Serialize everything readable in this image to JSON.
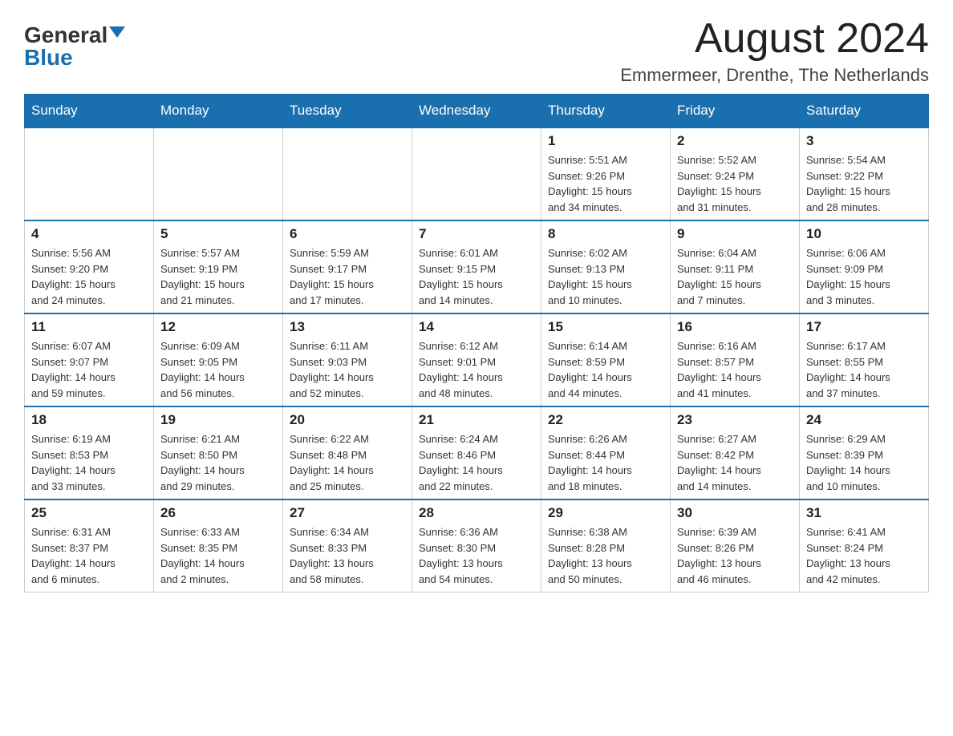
{
  "header": {
    "logo_general": "General",
    "logo_blue": "Blue",
    "month_title": "August 2024",
    "location": "Emmermeer, Drenthe, The Netherlands"
  },
  "weekdays": [
    "Sunday",
    "Monday",
    "Tuesday",
    "Wednesday",
    "Thursday",
    "Friday",
    "Saturday"
  ],
  "weeks": [
    [
      {
        "day": "",
        "info": ""
      },
      {
        "day": "",
        "info": ""
      },
      {
        "day": "",
        "info": ""
      },
      {
        "day": "",
        "info": ""
      },
      {
        "day": "1",
        "info": "Sunrise: 5:51 AM\nSunset: 9:26 PM\nDaylight: 15 hours\nand 34 minutes."
      },
      {
        "day": "2",
        "info": "Sunrise: 5:52 AM\nSunset: 9:24 PM\nDaylight: 15 hours\nand 31 minutes."
      },
      {
        "day": "3",
        "info": "Sunrise: 5:54 AM\nSunset: 9:22 PM\nDaylight: 15 hours\nand 28 minutes."
      }
    ],
    [
      {
        "day": "4",
        "info": "Sunrise: 5:56 AM\nSunset: 9:20 PM\nDaylight: 15 hours\nand 24 minutes."
      },
      {
        "day": "5",
        "info": "Sunrise: 5:57 AM\nSunset: 9:19 PM\nDaylight: 15 hours\nand 21 minutes."
      },
      {
        "day": "6",
        "info": "Sunrise: 5:59 AM\nSunset: 9:17 PM\nDaylight: 15 hours\nand 17 minutes."
      },
      {
        "day": "7",
        "info": "Sunrise: 6:01 AM\nSunset: 9:15 PM\nDaylight: 15 hours\nand 14 minutes."
      },
      {
        "day": "8",
        "info": "Sunrise: 6:02 AM\nSunset: 9:13 PM\nDaylight: 15 hours\nand 10 minutes."
      },
      {
        "day": "9",
        "info": "Sunrise: 6:04 AM\nSunset: 9:11 PM\nDaylight: 15 hours\nand 7 minutes."
      },
      {
        "day": "10",
        "info": "Sunrise: 6:06 AM\nSunset: 9:09 PM\nDaylight: 15 hours\nand 3 minutes."
      }
    ],
    [
      {
        "day": "11",
        "info": "Sunrise: 6:07 AM\nSunset: 9:07 PM\nDaylight: 14 hours\nand 59 minutes."
      },
      {
        "day": "12",
        "info": "Sunrise: 6:09 AM\nSunset: 9:05 PM\nDaylight: 14 hours\nand 56 minutes."
      },
      {
        "day": "13",
        "info": "Sunrise: 6:11 AM\nSunset: 9:03 PM\nDaylight: 14 hours\nand 52 minutes."
      },
      {
        "day": "14",
        "info": "Sunrise: 6:12 AM\nSunset: 9:01 PM\nDaylight: 14 hours\nand 48 minutes."
      },
      {
        "day": "15",
        "info": "Sunrise: 6:14 AM\nSunset: 8:59 PM\nDaylight: 14 hours\nand 44 minutes."
      },
      {
        "day": "16",
        "info": "Sunrise: 6:16 AM\nSunset: 8:57 PM\nDaylight: 14 hours\nand 41 minutes."
      },
      {
        "day": "17",
        "info": "Sunrise: 6:17 AM\nSunset: 8:55 PM\nDaylight: 14 hours\nand 37 minutes."
      }
    ],
    [
      {
        "day": "18",
        "info": "Sunrise: 6:19 AM\nSunset: 8:53 PM\nDaylight: 14 hours\nand 33 minutes."
      },
      {
        "day": "19",
        "info": "Sunrise: 6:21 AM\nSunset: 8:50 PM\nDaylight: 14 hours\nand 29 minutes."
      },
      {
        "day": "20",
        "info": "Sunrise: 6:22 AM\nSunset: 8:48 PM\nDaylight: 14 hours\nand 25 minutes."
      },
      {
        "day": "21",
        "info": "Sunrise: 6:24 AM\nSunset: 8:46 PM\nDaylight: 14 hours\nand 22 minutes."
      },
      {
        "day": "22",
        "info": "Sunrise: 6:26 AM\nSunset: 8:44 PM\nDaylight: 14 hours\nand 18 minutes."
      },
      {
        "day": "23",
        "info": "Sunrise: 6:27 AM\nSunset: 8:42 PM\nDaylight: 14 hours\nand 14 minutes."
      },
      {
        "day": "24",
        "info": "Sunrise: 6:29 AM\nSunset: 8:39 PM\nDaylight: 14 hours\nand 10 minutes."
      }
    ],
    [
      {
        "day": "25",
        "info": "Sunrise: 6:31 AM\nSunset: 8:37 PM\nDaylight: 14 hours\nand 6 minutes."
      },
      {
        "day": "26",
        "info": "Sunrise: 6:33 AM\nSunset: 8:35 PM\nDaylight: 14 hours\nand 2 minutes."
      },
      {
        "day": "27",
        "info": "Sunrise: 6:34 AM\nSunset: 8:33 PM\nDaylight: 13 hours\nand 58 minutes."
      },
      {
        "day": "28",
        "info": "Sunrise: 6:36 AM\nSunset: 8:30 PM\nDaylight: 13 hours\nand 54 minutes."
      },
      {
        "day": "29",
        "info": "Sunrise: 6:38 AM\nSunset: 8:28 PM\nDaylight: 13 hours\nand 50 minutes."
      },
      {
        "day": "30",
        "info": "Sunrise: 6:39 AM\nSunset: 8:26 PM\nDaylight: 13 hours\nand 46 minutes."
      },
      {
        "day": "31",
        "info": "Sunrise: 6:41 AM\nSunset: 8:24 PM\nDaylight: 13 hours\nand 42 minutes."
      }
    ]
  ]
}
